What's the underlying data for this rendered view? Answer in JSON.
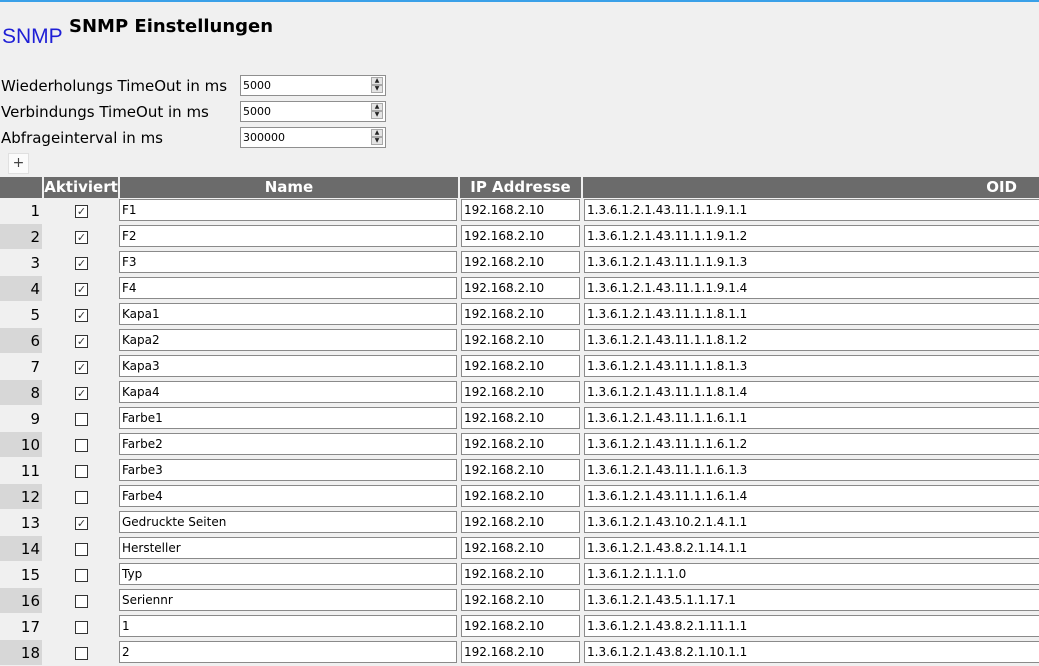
{
  "header": {
    "logo": "SNMP",
    "title": "SNMP Einstellungen"
  },
  "settings": {
    "retry": {
      "label": "Wiederholungs TimeOut in ms",
      "value": "5000"
    },
    "connect": {
      "label": "Verbindungs TimeOut in ms",
      "value": "5000"
    },
    "interval": {
      "label": "Abfrageinterval in ms",
      "value": "300000"
    }
  },
  "add_button": "+",
  "table": {
    "headers": {
      "active": "Aktiviert",
      "name": "Name",
      "ip": "IP Addresse",
      "oid": "OID"
    },
    "rows": [
      {
        "num": "1",
        "checked": true,
        "name": "F1",
        "ip": "192.168.2.10",
        "oid": "1.3.6.1.2.1.43.11.1.1.9.1.1"
      },
      {
        "num": "2",
        "checked": true,
        "name": "F2",
        "ip": "192.168.2.10",
        "oid": "1.3.6.1.2.1.43.11.1.1.9.1.2"
      },
      {
        "num": "3",
        "checked": true,
        "name": "F3",
        "ip": "192.168.2.10",
        "oid": "1.3.6.1.2.1.43.11.1.1.9.1.3"
      },
      {
        "num": "4",
        "checked": true,
        "name": "F4",
        "ip": "192.168.2.10",
        "oid": "1.3.6.1.2.1.43.11.1.1.9.1.4"
      },
      {
        "num": "5",
        "checked": true,
        "name": "Kapa1",
        "ip": "192.168.2.10",
        "oid": "1.3.6.1.2.1.43.11.1.1.8.1.1"
      },
      {
        "num": "6",
        "checked": true,
        "name": "Kapa2",
        "ip": "192.168.2.10",
        "oid": "1.3.6.1.2.1.43.11.1.1.8.1.2"
      },
      {
        "num": "7",
        "checked": true,
        "name": "Kapa3",
        "ip": "192.168.2.10",
        "oid": "1.3.6.1.2.1.43.11.1.1.8.1.3"
      },
      {
        "num": "8",
        "checked": true,
        "name": "Kapa4",
        "ip": "192.168.2.10",
        "oid": "1.3.6.1.2.1.43.11.1.1.8.1.4"
      },
      {
        "num": "9",
        "checked": false,
        "name": "Farbe1",
        "ip": "192.168.2.10",
        "oid": "1.3.6.1.2.1.43.11.1.1.6.1.1"
      },
      {
        "num": "10",
        "checked": false,
        "name": "Farbe2",
        "ip": "192.168.2.10",
        "oid": "1.3.6.1.2.1.43.11.1.1.6.1.2"
      },
      {
        "num": "11",
        "checked": false,
        "name": "Farbe3",
        "ip": "192.168.2.10",
        "oid": "1.3.6.1.2.1.43.11.1.1.6.1.3"
      },
      {
        "num": "12",
        "checked": false,
        "name": "Farbe4",
        "ip": "192.168.2.10",
        "oid": "1.3.6.1.2.1.43.11.1.1.6.1.4"
      },
      {
        "num": "13",
        "checked": true,
        "name": "Gedruckte Seiten",
        "ip": "192.168.2.10",
        "oid": "1.3.6.1.2.1.43.10.2.1.4.1.1"
      },
      {
        "num": "14",
        "checked": false,
        "name": "Hersteller",
        "ip": "192.168.2.10",
        "oid": "1.3.6.1.2.1.43.8.2.1.14.1.1"
      },
      {
        "num": "15",
        "checked": false,
        "name": "Typ",
        "ip": "192.168.2.10",
        "oid": "1.3.6.1.2.1.1.1.0"
      },
      {
        "num": "16",
        "checked": false,
        "name": "Seriennr",
        "ip": "192.168.2.10",
        "oid": "1.3.6.1.2.1.43.5.1.1.17.1"
      },
      {
        "num": "17",
        "checked": false,
        "name": "1",
        "ip": "192.168.2.10",
        "oid": "1.3.6.1.2.1.43.8.2.1.11.1.1"
      },
      {
        "num": "18",
        "checked": false,
        "name": "2",
        "ip": "192.168.2.10",
        "oid": "1.3.6.1.2.1.43.8.2.1.10.1.1"
      }
    ]
  }
}
